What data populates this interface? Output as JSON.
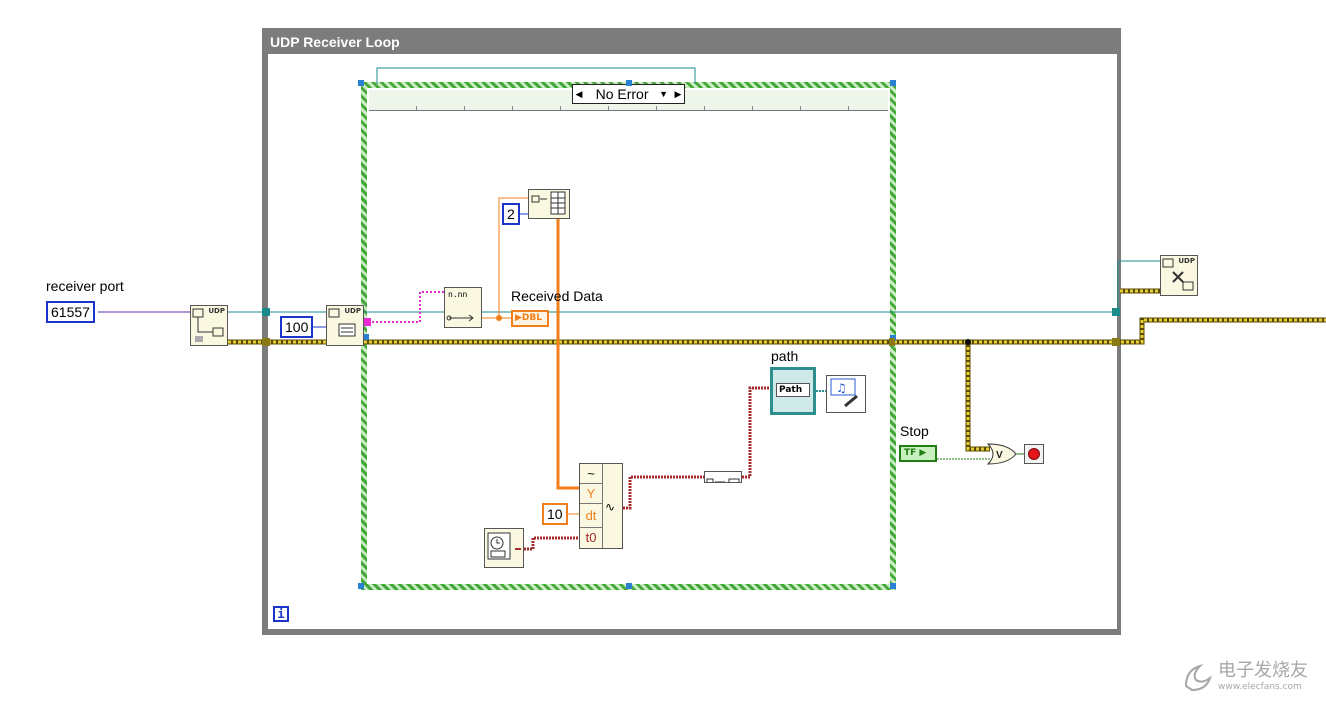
{
  "while_loop": {
    "title": "UDP Receiver Loop",
    "iteration_terminal": "i"
  },
  "case_structure": {
    "selector_value": "No Error"
  },
  "controls": {
    "receiver_port": {
      "label": "receiver port",
      "value": "61557"
    },
    "stop": {
      "label": "Stop",
      "type_text": "TF"
    }
  },
  "constants": {
    "timeout": "100",
    "dimension": "2",
    "dt": "10"
  },
  "indicators": {
    "received_data": {
      "label": "Received Data",
      "type_text": "DBL"
    },
    "path": {
      "label": "path",
      "type_text": "Path"
    }
  },
  "bundle_terms": {
    "y": "Y",
    "dt": "dt",
    "t0": "t0"
  },
  "node_tags": {
    "udp": "UDP",
    "format": "n.nn",
    "or_gate": "V"
  },
  "watermark": {
    "line1": "电子发烧友",
    "line2": "www.elecfans.com"
  },
  "colors": {
    "loop_frame": "#7c7c7c",
    "case_frame": "#43a838",
    "i32_wire": "#1b35c9",
    "dbl_wire": "#f07f1b",
    "string_wire": "#ea28d4",
    "boolean_wire": "#1f7d12",
    "error_wire": "#c8b300",
    "refnum_wire": "#1e8b8b",
    "cluster_wire": "#a52a2a"
  }
}
